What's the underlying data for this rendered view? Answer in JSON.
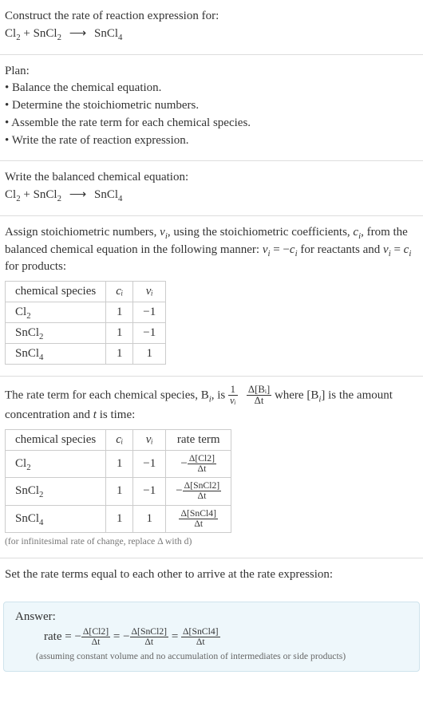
{
  "intro": {
    "prompt": "Construct the rate of reaction expression for:",
    "reactant1": "Cl",
    "reactant1_sub": "2",
    "plus1": " + ",
    "reactant2": "SnCl",
    "reactant2_sub": "2",
    "arrow": "⟶",
    "product1": "SnCl",
    "product1_sub": "4"
  },
  "plan": {
    "heading": "Plan:",
    "b1": "• Balance the chemical equation.",
    "b2": "• Determine the stoichiometric numbers.",
    "b3": "• Assemble the rate term for each chemical species.",
    "b4": "• Write the rate of reaction expression."
  },
  "balanced": {
    "heading": "Write the balanced chemical equation:"
  },
  "stoich": {
    "text_a": "Assign stoichiometric numbers, ",
    "nu": "ν",
    "i": "i",
    "text_b": ", using the stoichiometric coefficients, ",
    "c": "c",
    "text_c": ", from the balanced chemical equation in the following manner: ",
    "eq_react": " = −",
    "text_d": " for reactants and ",
    "eq_prod": " = ",
    "text_e": " for products:",
    "table": {
      "h1": "chemical species",
      "h2": "cᵢ",
      "h3": "νᵢ",
      "r1c1": "Cl",
      "r1c1_sub": "2",
      "r1c2": "1",
      "r1c3": "−1",
      "r2c1": "SnCl",
      "r2c1_sub": "2",
      "r2c2": "1",
      "r2c3": "−1",
      "r3c1": "SnCl",
      "r3c1_sub": "4",
      "r3c2": "1",
      "r3c3": "1"
    }
  },
  "rateterm": {
    "text_a": "The rate term for each chemical species, B",
    "text_b": ", is ",
    "one": "1",
    "nu_i": "νᵢ",
    "dB_num": "Δ[Bᵢ]",
    "dB_den": "Δt",
    "text_c": " where [B",
    "text_d": "] is the amount concentration and ",
    "t": "t",
    "text_e": " is time:",
    "table": {
      "h1": "chemical species",
      "h2": "cᵢ",
      "h3": "νᵢ",
      "h4": "rate term",
      "r1c1": "Cl",
      "r1c1_sub": "2",
      "r1c2": "1",
      "r1c3": "−1",
      "r1_num": "Δ[Cl2]",
      "r1_den": "Δt",
      "r1_sign": "−",
      "r2c1": "SnCl",
      "r2c1_sub": "2",
      "r2c2": "1",
      "r2c3": "−1",
      "r2_num": "Δ[SnCl2]",
      "r2_den": "Δt",
      "r2_sign": "−",
      "r3c1": "SnCl",
      "r3c1_sub": "4",
      "r3c2": "1",
      "r3c3": "1",
      "r3_num": "Δ[SnCl4]",
      "r3_den": "Δt",
      "r3_sign": ""
    },
    "note": "(for infinitesimal rate of change, replace Δ with d)"
  },
  "setequal": {
    "text": "Set the rate terms equal to each other to arrive at the rate expression:"
  },
  "answer": {
    "label": "Answer:",
    "rate": "rate = ",
    "neg": "−",
    "n1": "Δ[Cl2]",
    "d1": "Δt",
    "eq": " = ",
    "n2": "Δ[SnCl2]",
    "d2": "Δt",
    "n3": "Δ[SnCl4]",
    "d3": "Δt",
    "note": "(assuming constant volume and no accumulation of intermediates or side products)"
  },
  "chart_data": {
    "type": "table",
    "tables": [
      {
        "title": "Stoichiometric numbers",
        "columns": [
          "chemical species",
          "c_i",
          "ν_i"
        ],
        "rows": [
          [
            "Cl2",
            1,
            -1
          ],
          [
            "SnCl2",
            1,
            -1
          ],
          [
            "SnCl4",
            1,
            1
          ]
        ]
      },
      {
        "title": "Rate terms",
        "columns": [
          "chemical species",
          "c_i",
          "ν_i",
          "rate term"
        ],
        "rows": [
          [
            "Cl2",
            1,
            -1,
            "-Δ[Cl2]/Δt"
          ],
          [
            "SnCl2",
            1,
            -1,
            "-Δ[SnCl2]/Δt"
          ],
          [
            "SnCl4",
            1,
            1,
            "Δ[SnCl4]/Δt"
          ]
        ]
      }
    ],
    "final_expression": "rate = -Δ[Cl2]/Δt = -Δ[SnCl2]/Δt = Δ[SnCl4]/Δt"
  }
}
